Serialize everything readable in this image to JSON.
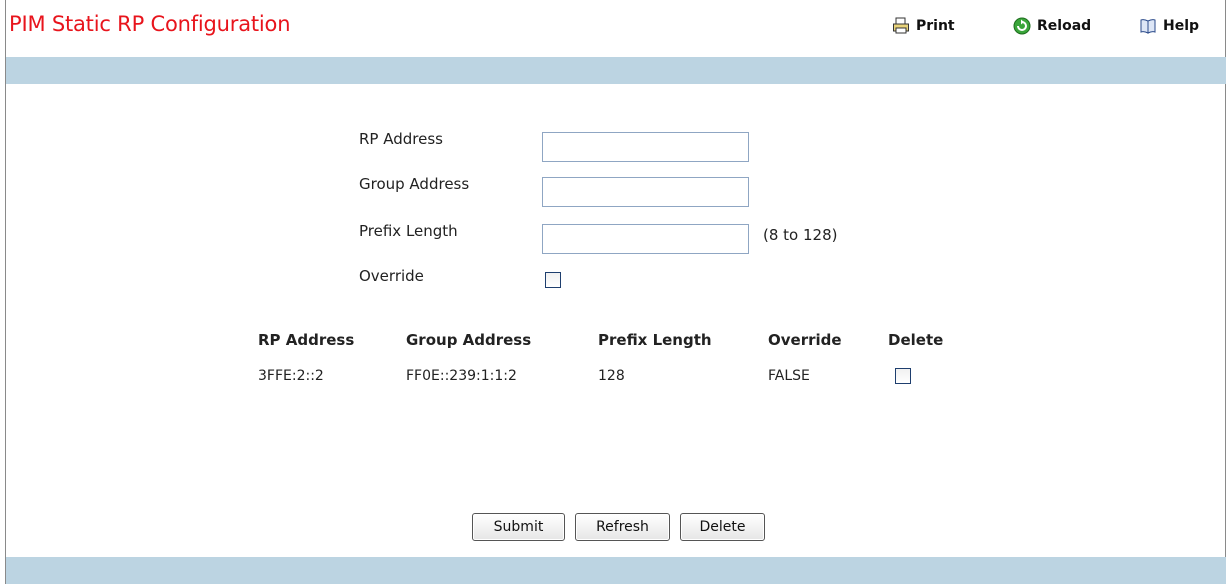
{
  "page": {
    "title": "PIM Static RP Configuration"
  },
  "toolbar": {
    "print": "Print",
    "reload": "Reload",
    "help": "Help"
  },
  "form": {
    "rp_address": {
      "label": "RP Address",
      "value": ""
    },
    "group_address": {
      "label": "Group Address",
      "value": ""
    },
    "prefix_length": {
      "label": "Prefix Length",
      "value": "",
      "hint": "(8 to 128)"
    },
    "override": {
      "label": "Override",
      "checked": false
    }
  },
  "table": {
    "headers": [
      "RP Address",
      "Group Address",
      "Prefix Length",
      "Override",
      "Delete"
    ],
    "rows": [
      {
        "rp_address": "3FFE:2::2",
        "group_address": "FF0E::239:1:1:2",
        "prefix_length": "128",
        "override": "FALSE",
        "delete_checked": false
      }
    ]
  },
  "buttons": {
    "submit": "Submit",
    "refresh": "Refresh",
    "delete": "Delete"
  },
  "colors": {
    "title": "#e8141c",
    "band": "#bcd4e2"
  }
}
